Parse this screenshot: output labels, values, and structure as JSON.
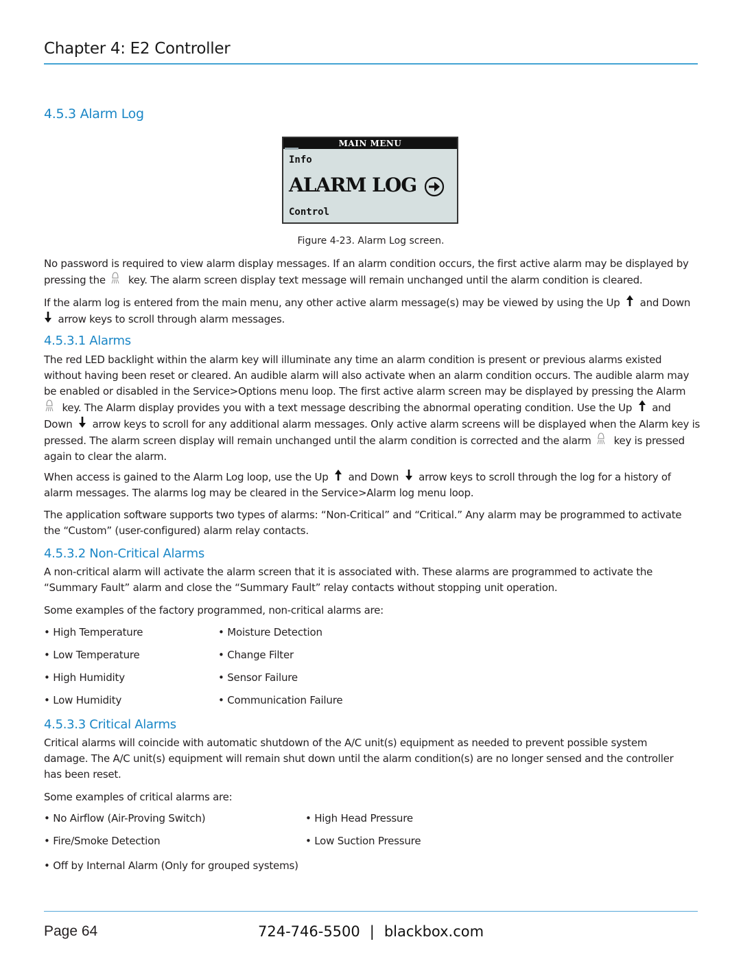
{
  "header": {
    "chapter_title": "Chapter 4: E2 Controller"
  },
  "section": {
    "title": "4.5.3 Alarm Log"
  },
  "figure": {
    "lcd": {
      "menu_title": "MAIN MENU",
      "line_prev": "Info",
      "line_current": "ALARM LOG",
      "line_next": "Control",
      "arrow_icon": "circled-right-arrow-icon"
    },
    "caption": "Figure 4-23. Alarm Log screen."
  },
  "intro": {
    "p1": {
      "l1": "No password is required to view alarm display messages. If an alarm condition occurs, the first active alarm may be displayed by",
      "l2a": "pressing the",
      "l2b": "key. The alarm screen display text message will remain unchanged until the alarm condition is cleared."
    },
    "p2": {
      "l1a": "If the alarm log is entered from the main menu, any other active alarm message(s) may be viewed by using the Up",
      "l1b": "and Down",
      "l2": "arrow keys to scroll through alarm messages."
    }
  },
  "alarms": {
    "title": "4.5.3.1 Alarms",
    "p1": {
      "l1": "The red LED backlight within the alarm key will illuminate any time an alarm condition is present or previous alarms existed",
      "l2": "without having been reset or cleared. An audible alarm will also activate when an alarm condition occurs. The audible alarm may",
      "l3": "be enabled or disabled in the Service>Options menu loop. The first active alarm screen may be displayed by pressing the Alarm",
      "l4a": "key. The Alarm display provides you with a text message describing the abnormal operating condition. Use the Up",
      "l4b": "and",
      "l5a": "Down",
      "l5b": "arrow keys to scroll for any additional alarm messages. Only active alarm screens will be displayed when the Alarm key is",
      "l6a": "pressed. The alarm screen display will remain unchanged until the alarm condition is corrected and the alarm",
      "l6b": "key is pressed",
      "l7": "again to clear the alarm."
    },
    "p2": {
      "l1a": "When access is gained to the Alarm Log loop, use the Up",
      "l1b": "and Down",
      "l1c": "arrow keys to scroll through the log for a history of",
      "l2": "alarm messages. The alarms log may be cleared in the Service>Alarm log menu loop."
    },
    "p3": {
      "l1": "The application software supports two types of alarms: “Non-Critical” and “Critical.” Any alarm may be programmed to activate",
      "l2": "the “Custom” (user-configured) alarm relay contacts."
    }
  },
  "non_critical": {
    "title": "4.5.3.2 Non-Critical Alarms",
    "p1": {
      "l1": "A non-critical alarm will activate the alarm screen that it is associated with. These alarms are programmed to activate the",
      "l2": "“Summary Fault” alarm and close the “Summary Fault” relay contacts without stopping unit operation."
    },
    "p2": "Some examples of the factory programmed, non-critical alarms are:",
    "examples": [
      "High Temperature",
      "Moisture Detection",
      "Low Temperature",
      "Change Filter",
      "High Humidity",
      "Sensor Failure",
      "Low Humidity",
      "Communication Failure"
    ]
  },
  "critical": {
    "title": "4.5.3.3 Critical Alarms",
    "p1": {
      "l1": "Critical alarms will coincide with automatic shutdown of the A/C unit(s) equipment as needed to prevent possible system",
      "l2": "damage. The A/C unit(s) equipment will remain shut down until the alarm condition(s) are no longer sensed and the controller",
      "l3": "has been reset."
    },
    "p2": "Some examples of critical alarms are:",
    "examples": [
      "No Airflow (Air-Proving Switch)",
      "High Head Pressure",
      "Fire/Smoke Detection",
      "Low Suction Pressure",
      "Off by Internal Alarm (Only for grouped systems)"
    ]
  },
  "footer": {
    "page": "Page 64",
    "phone": "724-746-5500",
    "separator": "|",
    "website": "blackbox.com"
  }
}
